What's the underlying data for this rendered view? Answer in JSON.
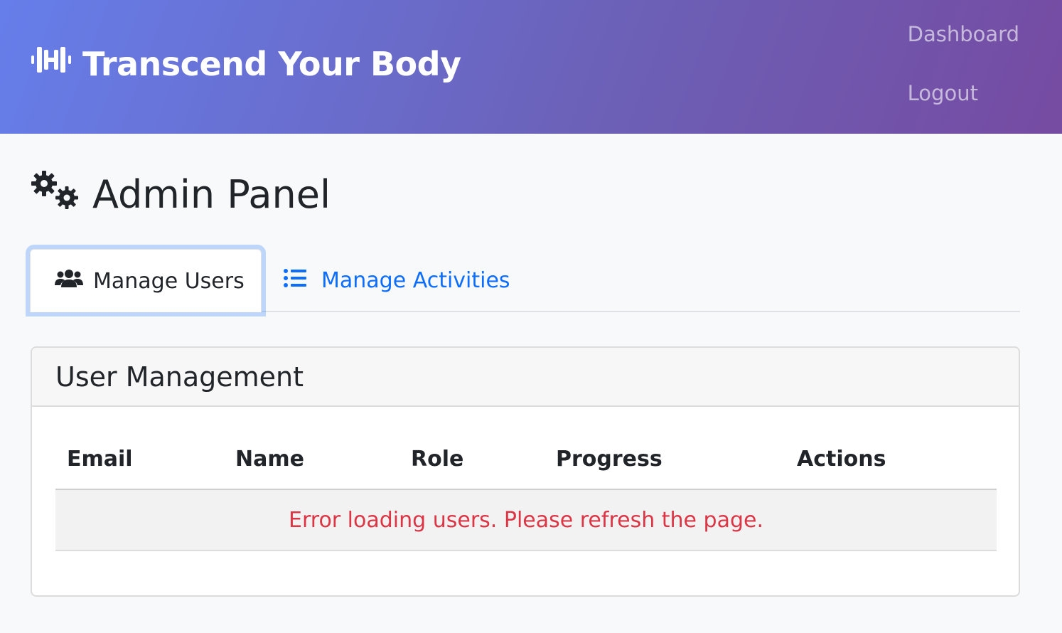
{
  "navbar": {
    "brand_icon": "dumbbell-icon",
    "brand_text": "Transcend Your Body",
    "links": [
      "Dashboard",
      "Logout"
    ]
  },
  "page": {
    "title_icon": "cogs-icon",
    "title": "Admin Panel"
  },
  "tabs": [
    {
      "icon": "users-icon",
      "label": "Manage Users",
      "active": true
    },
    {
      "icon": "list-icon",
      "label": "Manage Activities",
      "active": false
    }
  ],
  "card": {
    "title": "User Management",
    "table": {
      "columns": [
        "Email",
        "Name",
        "Role",
        "Progress",
        "Actions"
      ],
      "error_message": "Error loading users. Please refresh the page."
    }
  },
  "colors": {
    "header_gradient_start": "#667eea",
    "header_gradient_end": "#764ba2",
    "link_blue": "#0d6efd",
    "error_red": "#dc3545"
  }
}
